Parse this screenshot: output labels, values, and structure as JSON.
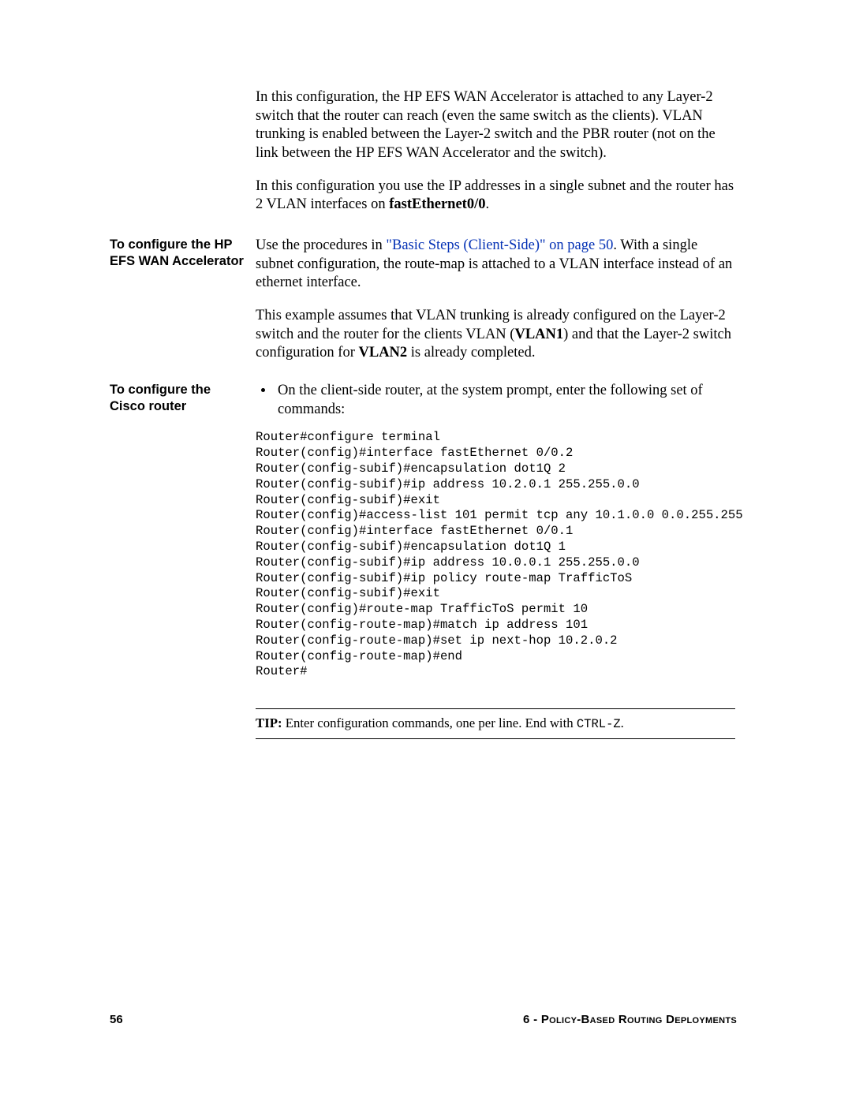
{
  "intro": {
    "p1a": "In this configuration, the HP EFS WAN Accelerator is attached to any Layer-2 switch that the router can reach (even the same switch as the clients). VLAN trunking is enabled between the Layer-2 switch and the PBR router (not on the link between the HP EFS WAN Accelerator and the switch).",
    "p2a": "In this configuration you use the IP addresses in a single subnet and the router has 2 VLAN interfaces on ",
    "p2b": "fastEthernet0/0",
    "p2c": "."
  },
  "sec1": {
    "label": "To configure the HP EFS WAN Accelerator",
    "p1a": "Use the procedures in ",
    "p1link": "\"Basic Steps (Client-Side)\" on page 50",
    "p1b": ". With a single subnet configuration, the route-map is attached to a VLAN interface instead of an ethernet interface.",
    "p2a": "This example assumes that VLAN trunking is already configured on the Layer-2 switch and the router for the clients VLAN (",
    "p2b": "VLAN1",
    "p2c": ") and that the Layer-2 switch configuration for ",
    "p2d": "VLAN2",
    "p2e": " is already completed."
  },
  "sec2": {
    "label": "To configure the Cisco router",
    "bullet": "On the client-side router, at the system prompt, enter the following set of commands:",
    "code": "Router#configure terminal\nRouter(config)#interface fastEthernet 0/0.2\nRouter(config-subif)#encapsulation dot1Q 2\nRouter(config-subif)#ip address 10.2.0.1 255.255.0.0\nRouter(config-subif)#exit\nRouter(config)#access-list 101 permit tcp any 10.1.0.0 0.0.255.255\nRouter(config)#interface fastEthernet 0/0.1\nRouter(config-subif)#encapsulation dot1Q 1\nRouter(config-subif)#ip address 10.0.0.1 255.255.0.0\nRouter(config-subif)#ip policy route-map TrafficToS\nRouter(config-subif)#exit\nRouter(config)#route-map TrafficToS permit 10\nRouter(config-route-map)#match ip address 101\nRouter(config-route-map)#set ip next-hop 10.2.0.2\nRouter(config-route-map)#end\nRouter#"
  },
  "tip": {
    "label": "TIP:",
    "textA": "  Enter configuration commands, one per line. End with ",
    "mono": "CTRL-Z",
    "textB": "."
  },
  "footer": {
    "page": "56",
    "chapter": "6 - Policy-Based Routing Deployments"
  }
}
